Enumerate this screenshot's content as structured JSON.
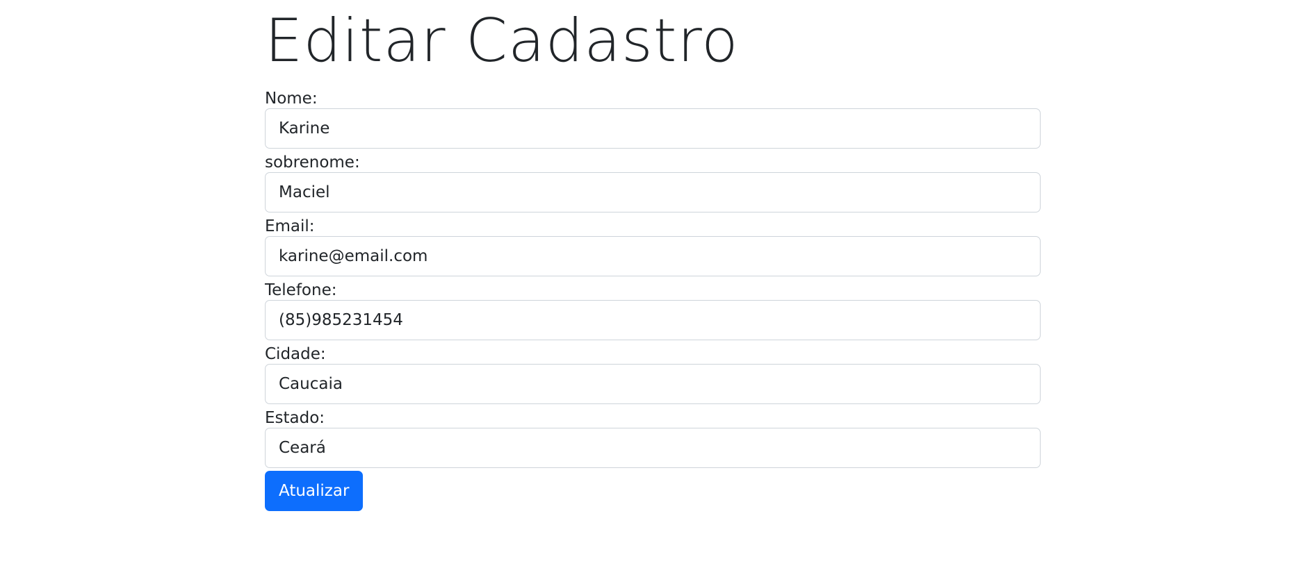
{
  "page": {
    "title": "Editar Cadastro"
  },
  "form": {
    "fields": [
      {
        "label": "Nome:",
        "value": "Karine"
      },
      {
        "label": "sobrenome:",
        "value": "Maciel"
      },
      {
        "label": "Email:",
        "value": "karine@email.com"
      },
      {
        "label": "Telefone:",
        "value": "(85)985231454"
      },
      {
        "label": "Cidade:",
        "value": "Caucaia"
      },
      {
        "label": "Estado:",
        "value": "Ceará"
      }
    ],
    "submit_label": "Atualizar"
  },
  "colors": {
    "primary": "#0d6efd",
    "text": "#212529",
    "border": "#ced4da"
  }
}
